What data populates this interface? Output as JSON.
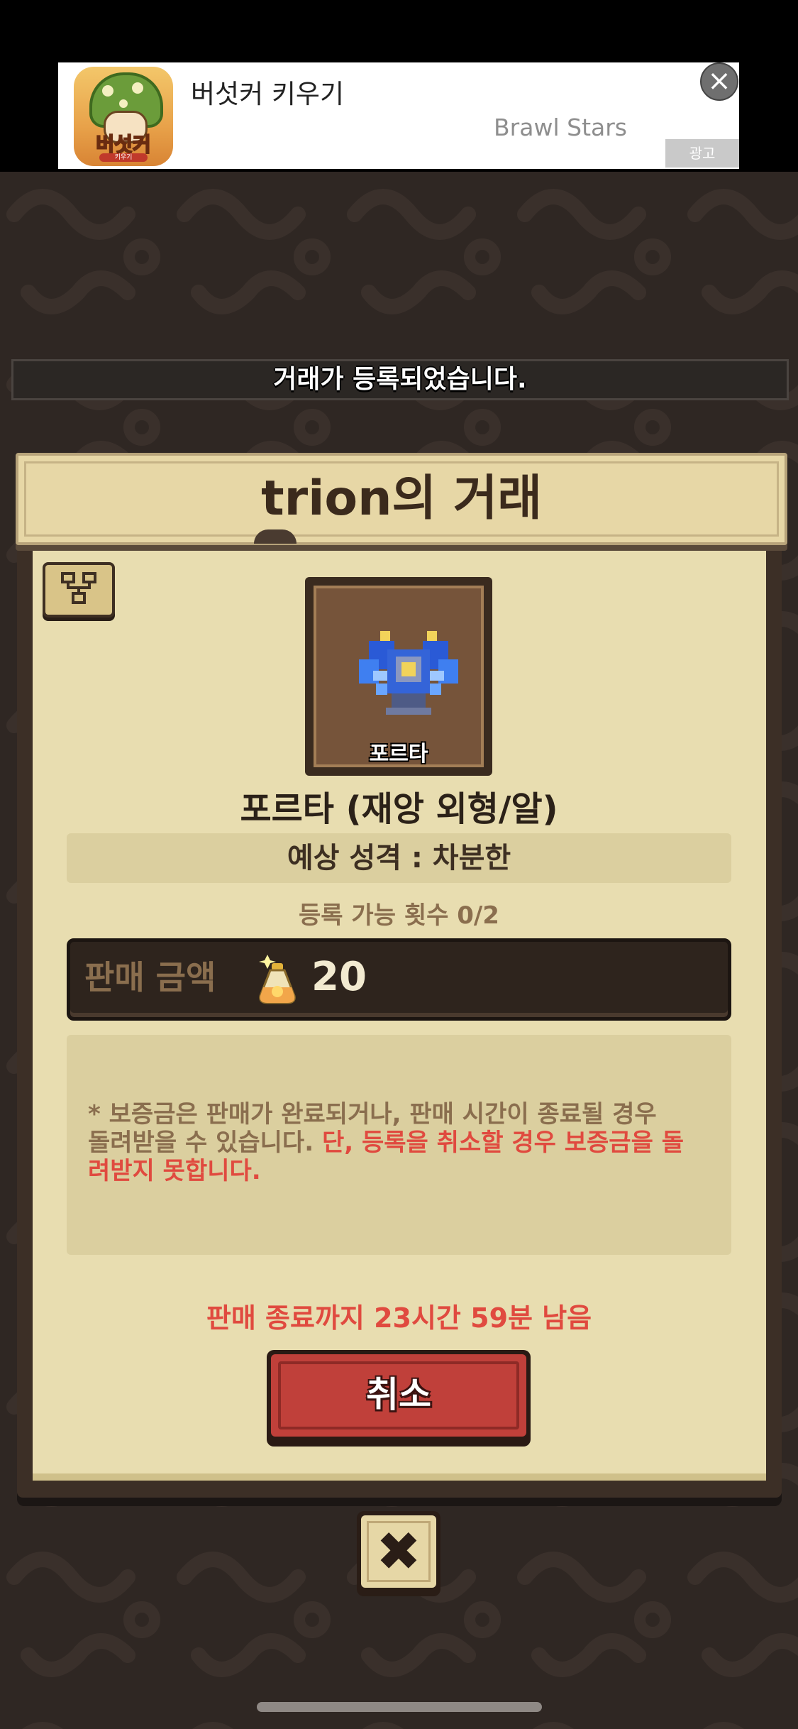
{
  "ad": {
    "app_name": "버섯커 키우기",
    "icon_text": "버섯커",
    "icon_subtext": "키우기",
    "advertiser": "Brawl Stars",
    "badge": "광고",
    "close_glyph": "×"
  },
  "notice": {
    "message": "거래가 등록되었습니다."
  },
  "dialog": {
    "title": "trion의 거래",
    "item_label": "포르타",
    "item_name": "포르타 (재앙 외형/알)",
    "personality": "예상 성격 : 차분한",
    "registration_count": "등록 가능 횟수 0/2",
    "price_label": "판매 금액",
    "price_value": "20",
    "currency_icon": "potion-icon",
    "info_text_normal": "* 보증금은 판매가 완료되거나, 판매 시간이 종료될 경우 돌려받을 수 있습니다.",
    "info_text_warning": "단, 등록을 취소할 경우 보증금을 돌려받지 못합니다.",
    "time_remaining": "판매 종료까지 23시간 59분 남음",
    "cancel_label": "취소",
    "close_glyph": "✖"
  },
  "colors": {
    "background": "#2f2723",
    "panel": "#e8ddb0",
    "accent_red": "#e04a3f",
    "button_red": "#c0403a",
    "text_brown": "#8a6e4e"
  }
}
